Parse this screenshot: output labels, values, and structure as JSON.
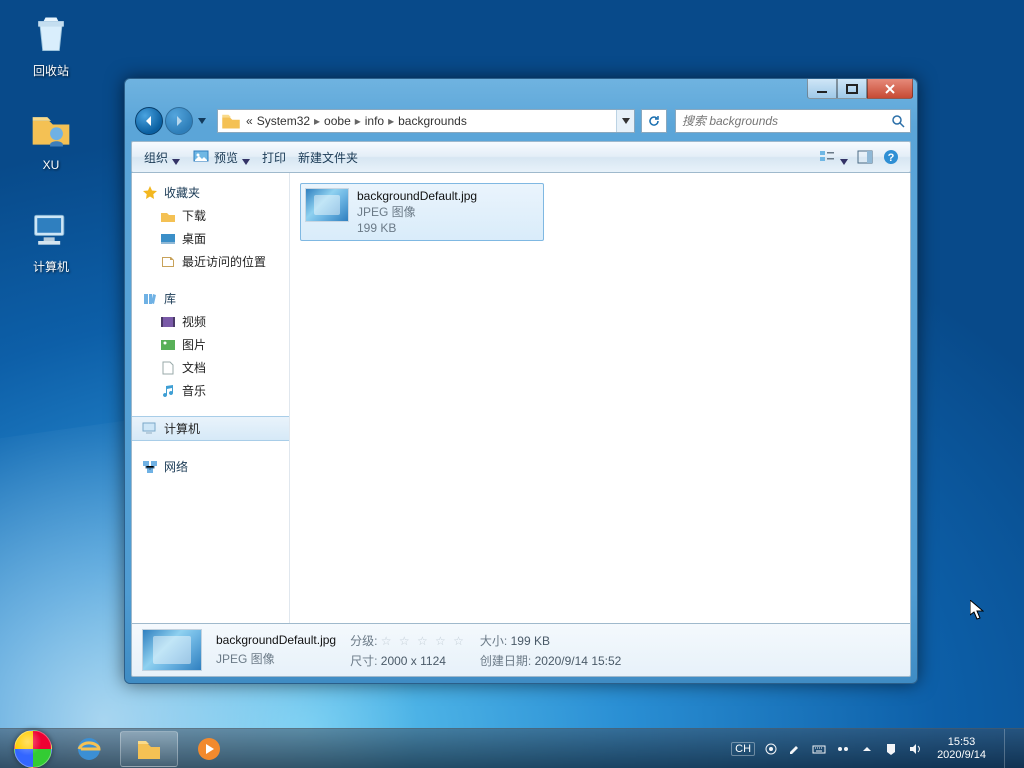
{
  "desktop": {
    "recycle_bin": "回收站",
    "folder_xu": "XU",
    "computer": "计算机"
  },
  "window": {
    "breadcrumb": {
      "overflow": "«",
      "p1": "System32",
      "p2": "oobe",
      "p3": "info",
      "p4": "backgrounds"
    },
    "search_placeholder": "搜索 backgrounds",
    "toolbar": {
      "organize": "组织",
      "preview": "预览",
      "print": "打印",
      "new_folder": "新建文件夹"
    },
    "sidebar": {
      "favorites": "收藏夹",
      "downloads": "下载",
      "desktop": "桌面",
      "recent": "最近访问的位置",
      "libraries": "库",
      "videos": "视频",
      "pictures": "图片",
      "documents": "文档",
      "music": "音乐",
      "computer": "计算机",
      "network": "网络"
    },
    "file": {
      "name": "backgroundDefault.jpg",
      "type": "JPEG 图像",
      "size": "199 KB"
    },
    "details": {
      "name": "backgroundDefault.jpg",
      "type": "JPEG 图像",
      "rating_label": "分级:",
      "dimensions_label": "尺寸:",
      "dimensions": "2000 x 1124",
      "size_label": "大小:",
      "size": "199 KB",
      "created_label": "创建日期:",
      "created": "2020/9/14 15:52"
    }
  },
  "taskbar": {
    "ime_lang": "CH",
    "time": "15:53",
    "date": "2020/9/14"
  }
}
